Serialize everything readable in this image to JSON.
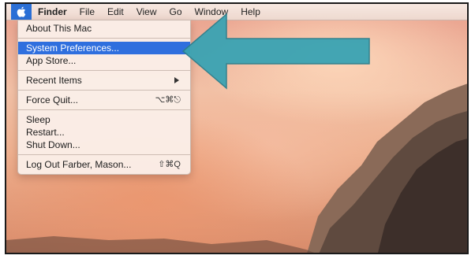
{
  "menubar": {
    "apple_icon": "apple-logo-icon",
    "items": [
      {
        "label": "Finder"
      },
      {
        "label": "File"
      },
      {
        "label": "Edit"
      },
      {
        "label": "View"
      },
      {
        "label": "Go"
      },
      {
        "label": "Window"
      },
      {
        "label": "Help"
      }
    ]
  },
  "apple_menu": {
    "about": "About This Mac",
    "system_preferences": "System Preferences...",
    "app_store": "App Store...",
    "recent_items": "Recent Items",
    "force_quit": "Force Quit...",
    "force_quit_shortcut": "⌥⌘⎋",
    "sleep": "Sleep",
    "restart": "Restart...",
    "shut_down": "Shut Down...",
    "log_out": "Log Out Farber, Mason...",
    "log_out_shortcut": "⇧⌘Q"
  },
  "colors": {
    "highlight": "#2f6fde",
    "callout_arrow": "#3aa3b3"
  }
}
